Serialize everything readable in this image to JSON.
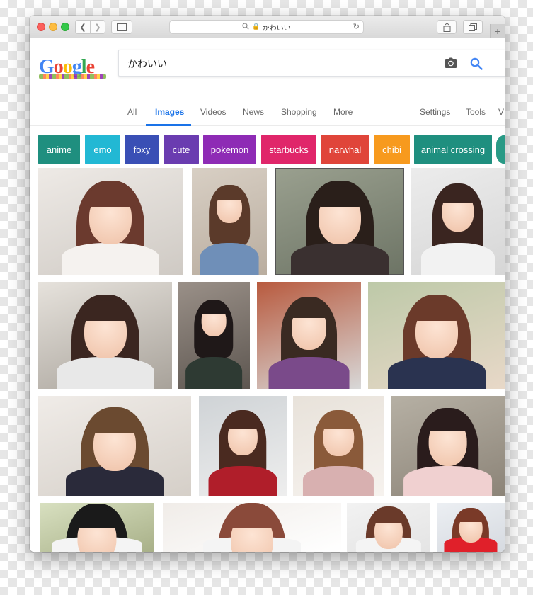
{
  "browser": {
    "url": "かわいい",
    "back_icon": "chevron-left-icon",
    "forward_icon": "chevron-right-icon",
    "new_tab_label": "+"
  },
  "search": {
    "query": "かわいい",
    "camera_icon": "camera-icon",
    "search_icon": "search-icon"
  },
  "logo": {
    "letters": [
      "G",
      "o",
      "o",
      "g",
      "l",
      "e"
    ]
  },
  "tabs": {
    "all": "All",
    "images": "Images",
    "videos": "Videos",
    "news": "News",
    "shopping": "Shopping",
    "more": "More",
    "settings": "Settings",
    "tools": "Tools",
    "overflow": "V"
  },
  "chips": [
    {
      "label": "anime",
      "color": "#1f8f7f"
    },
    {
      "label": "emo",
      "color": "#22b8d4"
    },
    {
      "label": "foxy",
      "color": "#3a4fb5"
    },
    {
      "label": "cute",
      "color": "#6a3cb0"
    },
    {
      "label": "pokemon",
      "color": "#8e2bb5"
    },
    {
      "label": "starbucks",
      "color": "#e0266a"
    },
    {
      "label": "narwhal",
      "color": "#e0453a"
    },
    {
      "label": "chibi",
      "color": "#f79a1e"
    },
    {
      "label": "animal crossing",
      "color": "#1f8f7f"
    },
    {
      "label": "",
      "color": "#2a9a86"
    }
  ],
  "accent_color": "#1a73e8"
}
